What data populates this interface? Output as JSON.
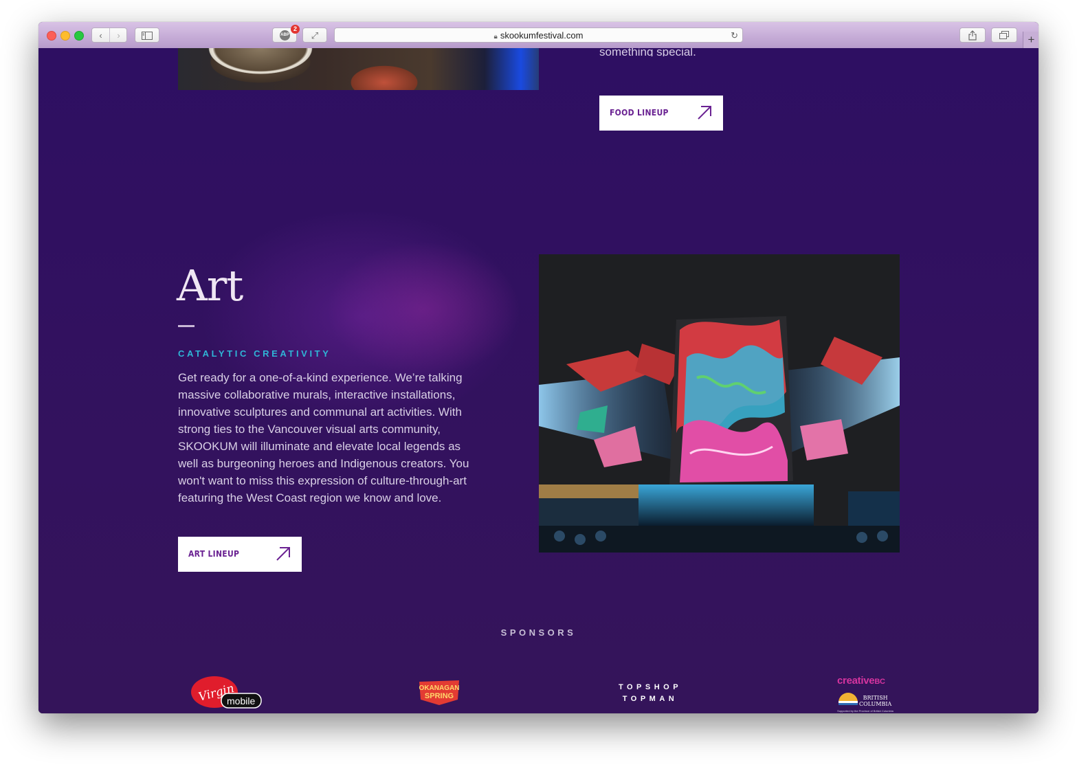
{
  "browser": {
    "url": "skookumfestival.com",
    "adblock_badge": "2",
    "adblock_label": "ABP"
  },
  "food": {
    "trailing_text": "something special.",
    "cta_label": "FOOD LINEUP"
  },
  "art": {
    "title": "Art",
    "subtitle": "CATALYTIC CREATIVITY",
    "body": "Get ready for a one-of-a-kind experience. We’re talking massive collaborative murals, interactive installations, innovative sculptures and communal art activities. With strong ties to the Vancouver visual arts community, SKOOKUM will illuminate and elevate local legends as well as burgeoning heroes and Indigenous creators. You won't want to miss this expression of culture-through-art featuring the West Coast region we know and love.",
    "cta_label": "ART LINEUP"
  },
  "sponsors": {
    "heading": "SPONSORS",
    "virgin": {
      "script": "Virgin",
      "mobile": "mobile"
    },
    "okanagan": {
      "line1": "OKANAGAN",
      "line2": "SPRING"
    },
    "topshop": {
      "line1": "TOPSHOP",
      "line2": "TOPMAN"
    },
    "creativebc": {
      "word": "creative",
      "bc": "BC",
      "province_line1": "BRITISH",
      "province_line2": "COLUMBIA",
      "note": "Supported by the Province of British Columbia"
    }
  },
  "colors": {
    "page_bg": "#2e0f62",
    "accent_cyan": "#2fb5d6",
    "cta_text": "#6a2292",
    "creative_pink": "#d6349f"
  }
}
